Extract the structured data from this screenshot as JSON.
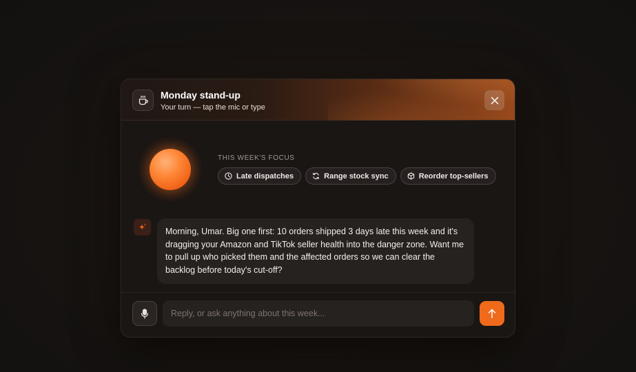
{
  "header": {
    "title": "Monday stand-up",
    "subtitle": "Your turn — tap the mic or type",
    "icon": "coffee-icon",
    "close_icon": "close-icon"
  },
  "focus": {
    "label": "THIS WEEK'S FOCUS",
    "chips": [
      {
        "label": "Late dispatches",
        "icon": "clock-icon"
      },
      {
        "label": "Range stock sync",
        "icon": "sync-icon"
      },
      {
        "label": "Reorder top-sellers",
        "icon": "box-icon"
      }
    ]
  },
  "message": {
    "avatar_icon": "sparkle-icon",
    "text": "Morning, Umar. Big one first: 10 orders shipped 3 days late this week and it's dragging your Amazon and TikTok seller health into the danger zone. Want me to pull up who picked them and the affected orders so we can clear the backlog before today's cut-off?"
  },
  "composer": {
    "placeholder": "Reply, or ask anything about this week...",
    "mic_icon": "microphone-icon",
    "send_icon": "arrow-up-icon"
  },
  "colors": {
    "accent": "#f06a1c",
    "background": "#171412",
    "panel": "#1a1614"
  }
}
